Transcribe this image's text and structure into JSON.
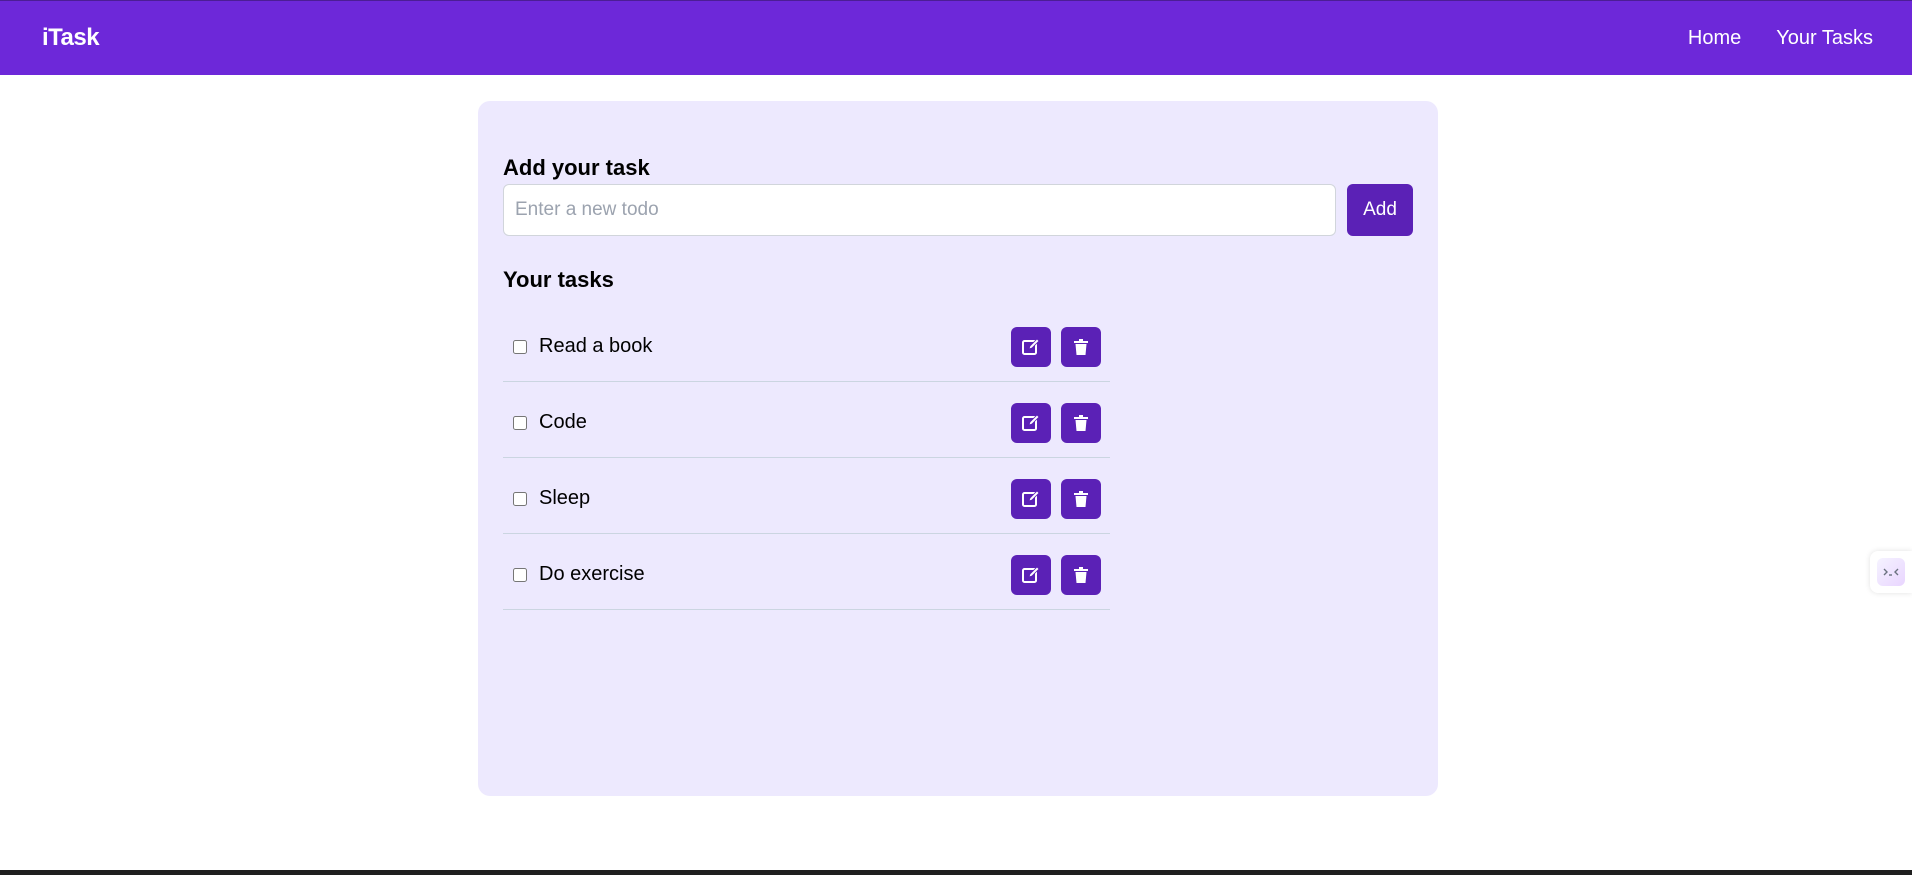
{
  "navbar": {
    "brand": "iTask",
    "links": [
      {
        "label": "Home"
      },
      {
        "label": "Your Tasks"
      }
    ]
  },
  "add_section": {
    "title": "Add your task",
    "input_placeholder": "Enter a new todo",
    "input_value": "",
    "add_label": "Add"
  },
  "tasks_section": {
    "title": "Your tasks",
    "tasks": [
      {
        "text": "Read a book",
        "done": false
      },
      {
        "text": "Code",
        "done": false
      },
      {
        "text": "Sleep",
        "done": false
      },
      {
        "text": "Do exercise",
        "done": false
      }
    ]
  },
  "icons": {
    "edit": "edit-icon",
    "delete": "trash-icon"
  },
  "colors": {
    "navbar": "#6d28d9",
    "card": "#ede9fe",
    "button": "#5b21b6"
  }
}
